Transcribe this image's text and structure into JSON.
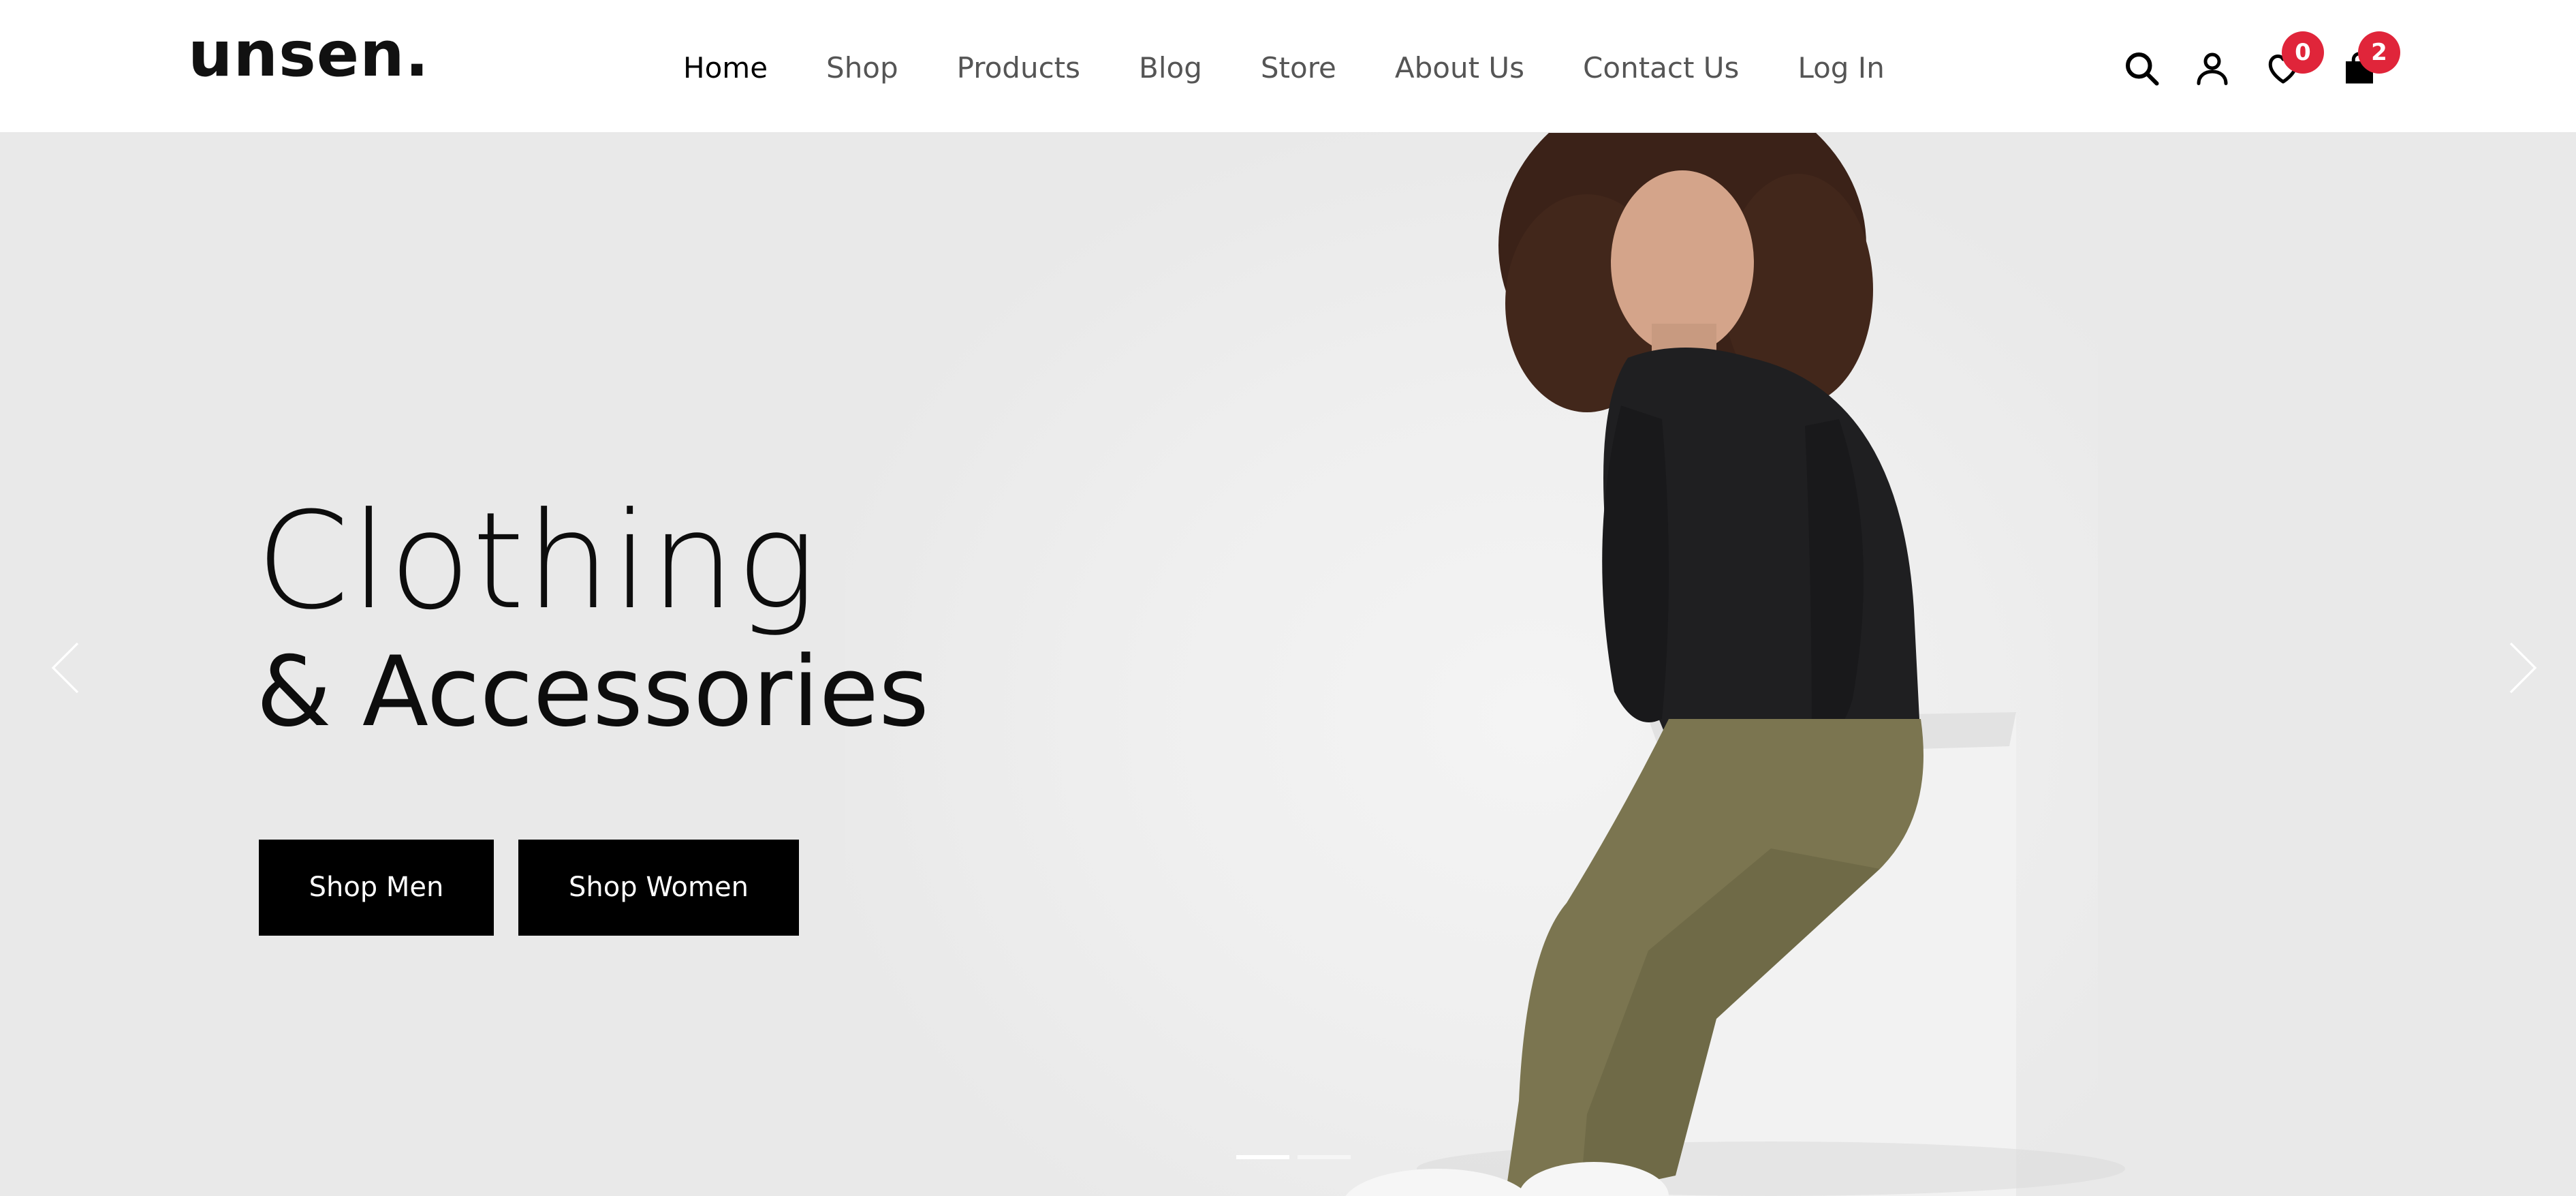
{
  "header": {
    "logo": "unsen.",
    "nav": [
      {
        "label": "Home",
        "active": true
      },
      {
        "label": "Shop",
        "active": false
      },
      {
        "label": "Products",
        "active": false
      },
      {
        "label": "Blog",
        "active": false
      },
      {
        "label": "Store",
        "active": false
      },
      {
        "label": "About Us",
        "active": false
      },
      {
        "label": "Contact Us",
        "active": false
      },
      {
        "label": "Log In",
        "active": false
      }
    ],
    "icons": {
      "search": "search-icon",
      "account": "user-icon",
      "wishlist": "heart-icon",
      "cart": "shopping-bag-icon"
    },
    "wishlist_count": "0",
    "cart_count": "2"
  },
  "hero": {
    "title_line1": "Clothing",
    "title_line2": "& Accessories",
    "buttons": {
      "men": "Shop Men",
      "women": "Shop Women"
    },
    "slide_count": 2,
    "active_slide": 1
  },
  "colors": {
    "badge": "#e0253a",
    "button_bg": "#000000",
    "hero_bg": "#e9e9e9",
    "nav_text": "#555555",
    "nav_active": "#000000"
  }
}
